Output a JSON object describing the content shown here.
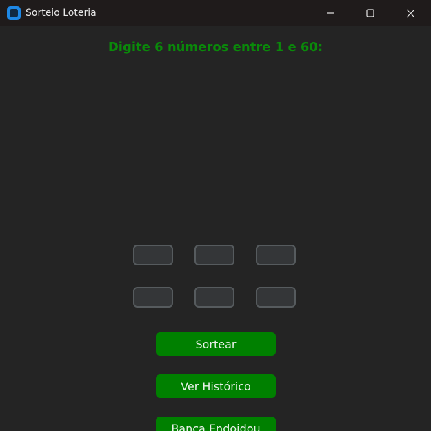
{
  "window": {
    "title": "Sorteio Loteria",
    "icon": "app-icon",
    "controls": [
      "minimize-icon",
      "maximize-icon",
      "close-icon"
    ]
  },
  "main": {
    "prompt": "Digite 6 números entre 1 e 60:",
    "number_inputs": [
      {
        "value": "",
        "placeholder": ""
      },
      {
        "value": "",
        "placeholder": ""
      },
      {
        "value": "",
        "placeholder": ""
      },
      {
        "value": "",
        "placeholder": ""
      },
      {
        "value": "",
        "placeholder": ""
      },
      {
        "value": "",
        "placeholder": ""
      }
    ],
    "buttons": {
      "sortear": "Sortear",
      "historico": "Ver Histórico",
      "banca": "Banca Endoidou"
    }
  },
  "colors": {
    "background": "#242424",
    "titlebar": "#1f1b1b",
    "prompt_text": "#0a8a0a",
    "button": "#008000",
    "input_bg": "#343638",
    "input_border": "#565b5e"
  }
}
